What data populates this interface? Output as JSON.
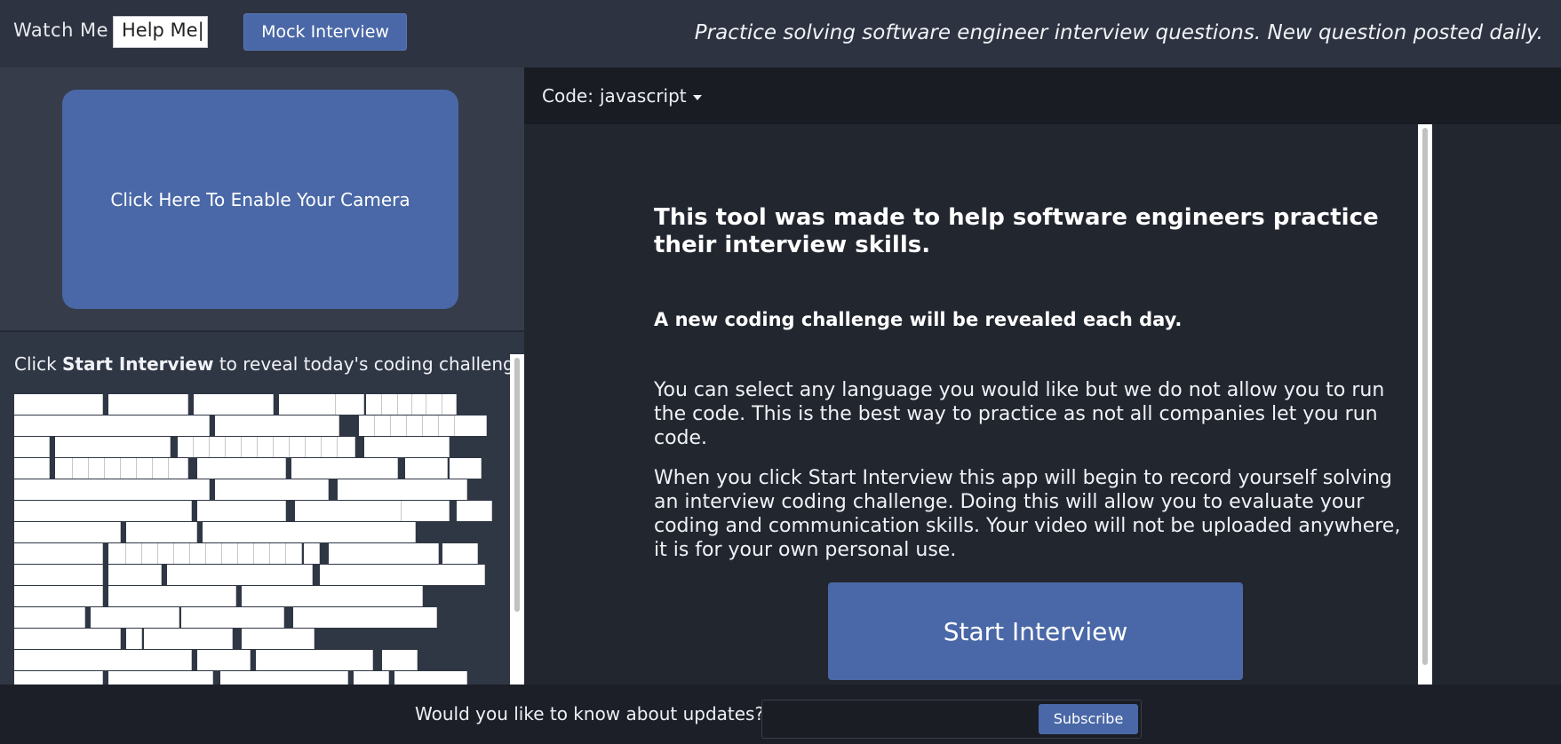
{
  "header": {
    "logo": "Watch  Me",
    "logo_input_value": "Help  Me|",
    "mock_interview_label": "Mock Interview",
    "tagline": "Practice solving software engineer interview questions. New question posted daily."
  },
  "left": {
    "camera_label": "Click Here To Enable Your Camera",
    "intro_prefix": "Click ",
    "intro_bold": "Start Interview",
    "intro_suffix": " to reveal today's coding challenge"
  },
  "code_bar": {
    "label": "Code:",
    "language": "javascript"
  },
  "content": {
    "heading": "This tool was made to help software engineers practice their interview skills.",
    "subheading": "A new coding challenge will be revealed each day.",
    "paragraph1": "You can select any language you would like but we do not allow you to run the code. This is the best way to practice as not all companies let you run code.",
    "paragraph2": "When you click Start Interview this app will begin to record yourself solving an interview coding challenge. Doing this will allow you to evaluate your coding and communication skills. Your video will not be uploaded anywhere, it is for your own personal use.",
    "start_label": "Start Interview"
  },
  "footer": {
    "question": "Would you like to know about updates?",
    "email_value": "",
    "subscribe_label": "Subscribe"
  },
  "colors": {
    "accent": "#4a68a7",
    "header_bg": "#2d3340",
    "editor_bg": "#22262f",
    "footer_bg": "#1c1f27"
  }
}
